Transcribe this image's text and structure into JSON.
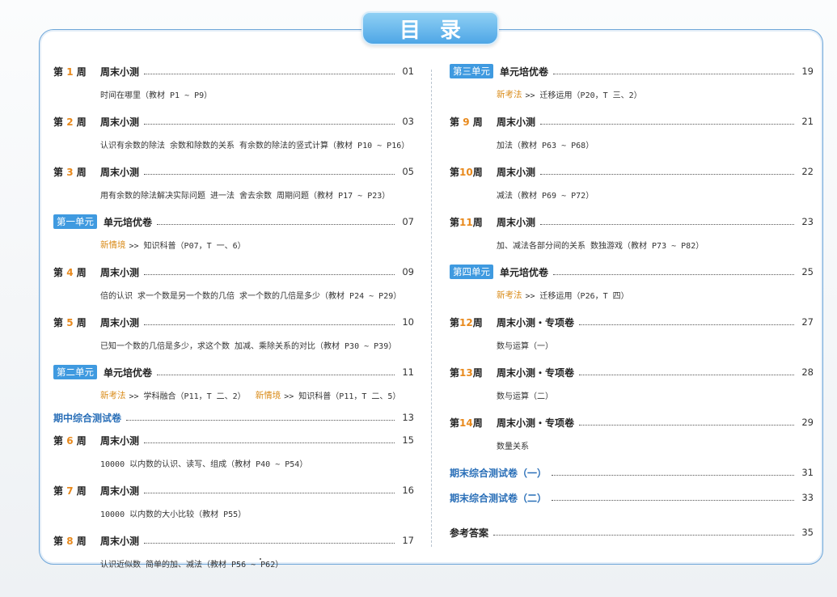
{
  "title": "目录",
  "left": {
    "w1": {
      "pre": "第",
      "num": "1",
      "post": "周",
      "label": "周末小测",
      "page": "01",
      "sub": "时间在哪里（教材 P1 ~ P9）"
    },
    "w2": {
      "pre": "第",
      "num": "2",
      "post": "周",
      "label": "周末小测",
      "page": "03",
      "sub": "认识有余数的除法  余数和除数的关系  有余数的除法的竖式计算（教材 P10 ~ P16）"
    },
    "w3": {
      "pre": "第",
      "num": "3",
      "post": "周",
      "label": "周末小测",
      "page": "05",
      "sub": "用有余数的除法解决实际问题  进一法  舍去余数  周期问题（教材 P17 ~ P23）"
    },
    "u1": {
      "tag": "第一单元",
      "label": "单元培优卷",
      "page": "07",
      "hl1": "新情境",
      "sub1": ">> 知识科普（P07，T 一、6）"
    },
    "w4": {
      "pre": "第",
      "num": "4",
      "post": "周",
      "label": "周末小测",
      "page": "09",
      "sub": "倍的认识  求一个数是另一个数的几倍  求一个数的几倍是多少（教材 P24 ~ P29）"
    },
    "w5": {
      "pre": "第",
      "num": "5",
      "post": "周",
      "label": "周末小测",
      "page": "10",
      "sub": "已知一个数的几倍是多少，求这个数  加减、乘除关系的对比（教材 P30 ~ P39）"
    },
    "u2": {
      "tag": "第二单元",
      "label": "单元培优卷",
      "page": "11",
      "hl1": "新考法",
      "sub1": ">> 学科融合（P11，T 二、2）",
      "hl2": "新情境",
      "sub2": ">> 知识科普（P11，T 二、5）"
    },
    "mid": {
      "label": "期中综合测试卷",
      "page": "13"
    },
    "w6": {
      "pre": "第",
      "num": "6",
      "post": "周",
      "label": "周末小测",
      "page": "15",
      "sub": "10000 以内数的认识、读写、组成（教材 P40 ~ P54）"
    },
    "w7": {
      "pre": "第",
      "num": "7",
      "post": "周",
      "label": "周末小测",
      "page": "16",
      "sub": "10000 以内数的大小比较（教材 P55）"
    },
    "w8": {
      "pre": "第",
      "num": "8",
      "post": "周",
      "label": "周末小测",
      "page": "17",
      "sub": "认识近似数  简单的加、减法（教材 P56 ~ P62）"
    }
  },
  "right": {
    "u3": {
      "tag": "第三单元",
      "label": "单元培优卷",
      "page": "19",
      "hl1": "新考法",
      "sub1": ">> 迁移运用（P20，T 三、2）"
    },
    "w9": {
      "pre": "第",
      "num": "9",
      "post": "周",
      "label": "周末小测",
      "page": "21",
      "sub": "加法（教材 P63 ~ P68）"
    },
    "w10": {
      "pre": "第",
      "num": "10",
      "post": "周",
      "label": "周末小测",
      "page": "22",
      "sub": "减法（教材 P69 ~ P72）"
    },
    "w11": {
      "pre": "第",
      "num": "11",
      "post": "周",
      "label": "周末小测",
      "page": "23",
      "sub": "加、减法各部分间的关系  数独游戏（教材 P73 ~ P82）"
    },
    "u4": {
      "tag": "第四单元",
      "label": "单元培优卷",
      "page": "25",
      "hl1": "新考法",
      "sub1": ">> 迁移运用（P26，T 四）"
    },
    "w12": {
      "pre": "第",
      "num": "12",
      "post": "周",
      "label": "周末小测・专项卷",
      "page": "27",
      "sub": "数与运算（一）"
    },
    "w13": {
      "pre": "第",
      "num": "13",
      "post": "周",
      "label": "周末小测・专项卷",
      "page": "28",
      "sub": "数与运算（二）"
    },
    "w14": {
      "pre": "第",
      "num": "14",
      "post": "周",
      "label": "周末小测・专项卷",
      "page": "29",
      "sub": "数量关系"
    },
    "final1": {
      "label": "期末综合测试卷（一）",
      "page": "31"
    },
    "final2": {
      "label": "期末综合测试卷（二）",
      "page": "33"
    },
    "answers": {
      "label": "参考答案",
      "page": "35"
    }
  }
}
